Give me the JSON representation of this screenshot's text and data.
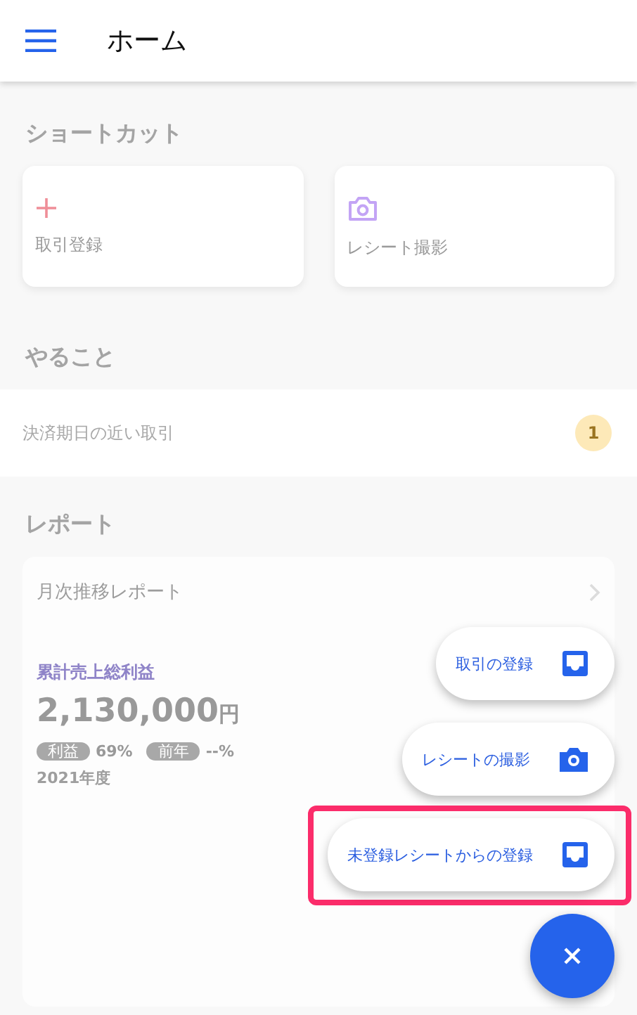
{
  "header": {
    "title": "ホーム"
  },
  "shortcuts": {
    "title": "ショートカット",
    "items": [
      {
        "kind": "plus",
        "label": "取引登録"
      },
      {
        "kind": "camera",
        "label": "レシート撮影"
      }
    ]
  },
  "todo": {
    "title": "やること",
    "items": [
      {
        "label": "決済期日の近い取引",
        "count": "1"
      }
    ]
  },
  "report": {
    "title": "レポート",
    "card": {
      "title": "月次推移レポート",
      "metric_label": "累計売上総利益",
      "amount": "2,130,000",
      "unit": "円",
      "tags": [
        {
          "label": "利益",
          "value": "69%"
        },
        {
          "label": "前年",
          "value": "--%"
        }
      ],
      "period": "2021年度"
    }
  },
  "fab_menu": {
    "items": [
      {
        "label": "取引の登録",
        "kind": "inbox",
        "highlighted": false
      },
      {
        "label": "レシートの撮影",
        "kind": "camera",
        "highlighted": false
      },
      {
        "label": "未登録レシートからの登録",
        "kind": "inbox",
        "highlighted": true
      }
    ],
    "expanded": true
  }
}
